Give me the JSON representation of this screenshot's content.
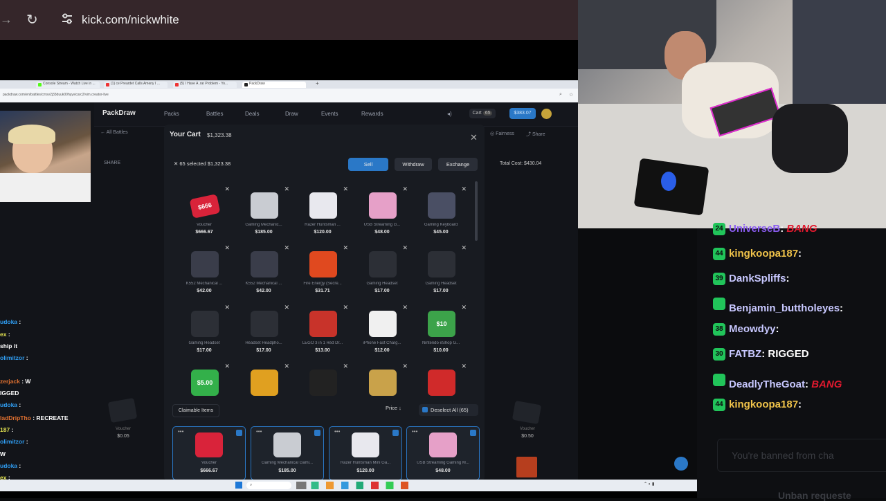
{
  "browser": {
    "url": "kick.com/nickwhite",
    "inner_tabs": [
      "Console Stream - Watch Live in ...",
      "(1) ce Preardet Calls Ameny I ...",
      "(5) I Have A .rar Problem - Yo...",
      "PackDraw"
    ],
    "inner_url": "packdraw.com/en/battles/cmsv2j33duuk00hyyvicarc2/vim.creator-live"
  },
  "site": {
    "logo": "PackDraw",
    "nav": [
      "Packs",
      "Battles",
      "Deals",
      "Draw",
      "Events",
      "Rewards"
    ],
    "cart_label": "Cart",
    "cart_count": "65",
    "balance": "$383.07",
    "back": "All Battles",
    "share_left": "SHARE",
    "fairness": "Fairness",
    "share": "Share",
    "total_cost": "Total Cost: $430.04"
  },
  "modal": {
    "title": "Your Cart",
    "total": "$1,323.38",
    "selected": "65 selected $1,323.38",
    "actions": [
      "Sell",
      "Withdraw",
      "Exchange"
    ],
    "items": [
      {
        "name": "Voucher",
        "price": "$666.67",
        "color": "#d9233a",
        "label": "$666"
      },
      {
        "name": "Gaming Mechanic...",
        "price": "$185.00",
        "color": "#c9ccd2",
        "label": ""
      },
      {
        "name": "Razer Huntsman ...",
        "price": "$120.00",
        "color": "#e8e8ee",
        "label": ""
      },
      {
        "name": "USB Streaming G...",
        "price": "$48.00",
        "color": "#e6a0c8",
        "label": ""
      },
      {
        "name": "Gaming Keyboard",
        "price": "$45.00",
        "color": "#4a4f64",
        "label": ""
      },
      {
        "name": "K552 Mechanical ...",
        "price": "$42.00",
        "color": "#3a3d4a",
        "label": ""
      },
      {
        "name": "K552 Mechanical ...",
        "price": "$42.00",
        "color": "#3a3d4a",
        "label": ""
      },
      {
        "name": "Fire Energy (Secre...",
        "price": "$31.71",
        "color": "#e0491f",
        "label": ""
      },
      {
        "name": "Gaming Headset",
        "price": "$17.00",
        "color": "#2c2f36",
        "label": ""
      },
      {
        "name": "Gaming Headset",
        "price": "$17.00",
        "color": "#2c2f36",
        "label": ""
      },
      {
        "name": "Gaming Headset",
        "price": "$17.00",
        "color": "#2c2f36",
        "label": ""
      },
      {
        "name": "Headset Headpho...",
        "price": "$17.00",
        "color": "#2c2f36",
        "label": ""
      },
      {
        "name": "LEGO 3 in 1 Red Dr...",
        "price": "$13.00",
        "color": "#c8332a",
        "label": ""
      },
      {
        "name": "iPhone Fast Charg...",
        "price": "$12.00",
        "color": "#f0f0f0",
        "label": ""
      },
      {
        "name": "Nintendo eShop G...",
        "price": "$10.00",
        "color": "#3ca34a",
        "label": "$10"
      },
      {
        "name": "",
        "price": "",
        "color": "#33b04a",
        "label": "$5.00"
      },
      {
        "name": "",
        "price": "",
        "color": "#e0a020",
        "label": ""
      },
      {
        "name": "",
        "price": "",
        "color": "#222",
        "label": ""
      },
      {
        "name": "",
        "price": "",
        "color": "#c9a24a",
        "label": ""
      },
      {
        "name": "",
        "price": "",
        "color": "#d02a2a",
        "label": ""
      }
    ]
  },
  "claimable": {
    "label": "Claimable Items",
    "price_sort": "Price",
    "deselect": "Deselect All (65)",
    "cards": [
      {
        "name": "Voucher",
        "price": "$666.67"
      },
      {
        "name": "Gaming Mechanical Gami...",
        "price": "$185.00"
      },
      {
        "name": "Razer Huntsman Mini Ga...",
        "price": "$120.00"
      },
      {
        "name": "USB Streaming Gaming M...",
        "price": "$48.00"
      }
    ],
    "side_left": [
      {
        "name": "Voucher",
        "price": "$0.05"
      }
    ],
    "side_right": [
      {
        "name": "Voucher",
        "price": "$0.50"
      }
    ]
  },
  "left_chat": [
    {
      "user": "udoka",
      "msg": "",
      "color": "#2f9cf0"
    },
    {
      "user": "ex",
      "msg": "",
      "color": "#e0e050"
    },
    {
      "user": "",
      "msg": "ship it",
      "color": "#ffffff"
    },
    {
      "user": "olimitzor",
      "msg": "",
      "color": "#2f9cf0"
    },
    {
      "user": "",
      "msg": "",
      "color": "#ffffff"
    },
    {
      "user": "zerjack",
      "msg": "W",
      "color": "#e07030"
    },
    {
      "user": "",
      "msg": "IGGED",
      "color": "#ffffff"
    },
    {
      "user": "udoka",
      "msg": "",
      "color": "#2f9cf0"
    },
    {
      "user": "ladDripTho",
      "msg": "RECREATE",
      "color": "#e07030"
    },
    {
      "user": "187",
      "msg": "",
      "color": "#e0e050"
    },
    {
      "user": "olimitzor",
      "msg": "",
      "color": "#2f9cf0"
    },
    {
      "user": "",
      "msg": "W",
      "color": "#ffffff"
    },
    {
      "user": "udoka",
      "msg": "",
      "color": "#2f9cf0"
    },
    {
      "user": "ex",
      "msg": "",
      "color": "#e0e050"
    }
  ],
  "chat": [
    {
      "badge": "24",
      "user": "UniverseB",
      "msg": "BANG",
      "color": "#8a5cf0"
    },
    {
      "badge": "44",
      "user": "kingkoopa187",
      "msg": "",
      "color": "#f0c34a"
    },
    {
      "badge": "39",
      "user": "DankSpliffs",
      "msg": "",
      "color": "#c8c8ff"
    },
    {
      "badge": "",
      "user": "Benjamin_buttholeyes",
      "msg": "",
      "color": "#c8c8ff"
    },
    {
      "badge": "38",
      "user": "Meowdyy",
      "msg": "",
      "color": "#c8c8ff"
    },
    {
      "badge": "30",
      "user": "FATBZ",
      "msg": "RIGGED",
      "color": "#c8c8ff"
    },
    {
      "badge": "",
      "user": "DeadlyTheGoat",
      "msg": "BANG",
      "color": "#c8c8ff"
    },
    {
      "badge": "44",
      "user": "kingkoopa187",
      "msg": "",
      "color": "#f0c34a"
    }
  ],
  "banned_text": "You're banned from cha",
  "unban_text": "Unban requeste"
}
